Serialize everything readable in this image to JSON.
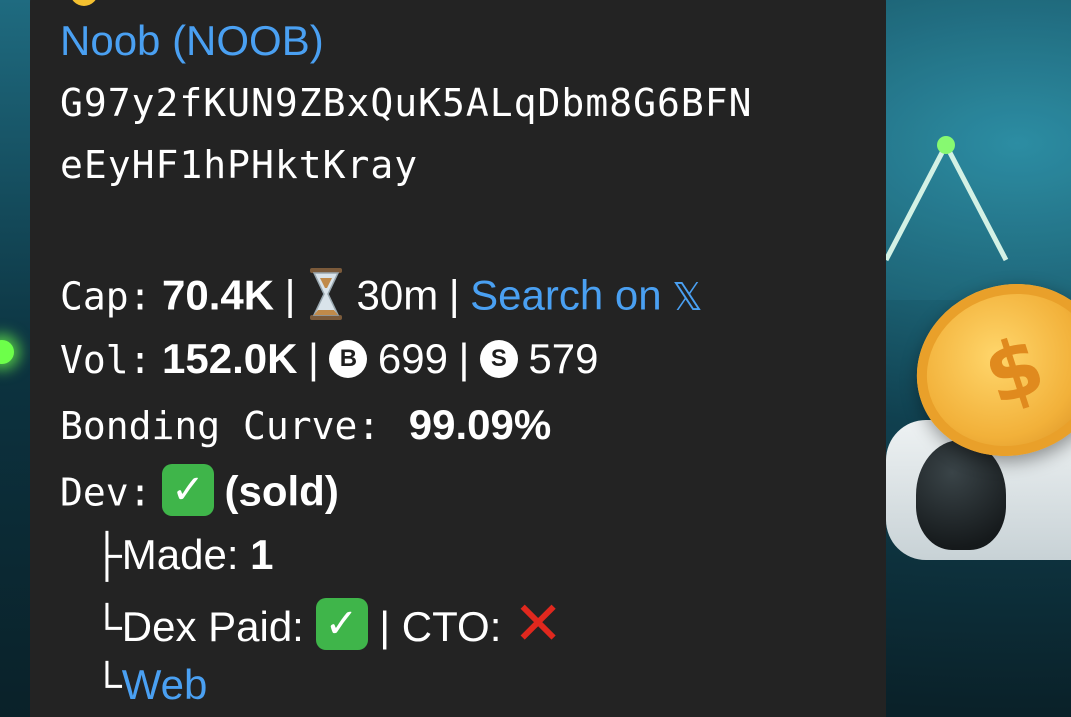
{
  "token": {
    "name_link": "Noob (NOOB)",
    "address_line1": "G97y2fKUN9ZBxQuK5ALqDbm8G6BFN",
    "address_line2": "eEyHF1hPHktKray"
  },
  "cap": {
    "label": "Cap:",
    "value": "70.4K",
    "sep1": "|",
    "age": "30m",
    "sep2": "|",
    "search_link": "Search on",
    "x_glyph": "𝕏",
    "hourglass_icon": "hourglass-icon"
  },
  "vol": {
    "label": "Vol:",
    "value": "152.0K",
    "sep1": "|",
    "buy_badge": "B",
    "buys": "699",
    "sep2": "|",
    "sell_badge": "S",
    "sells": "579"
  },
  "bonding": {
    "label": "Bonding Curve:",
    "value": "99.09%"
  },
  "dev": {
    "label": "Dev:",
    "check_icon": "check-mark-icon",
    "status": "(sold)"
  },
  "made": {
    "prefix": "├",
    "label": "Made:",
    "value": "1"
  },
  "dex": {
    "prefix": "└",
    "label": "Dex Paid:",
    "sep": "|",
    "cto_label": "CTO:",
    "cross_icon": "cross-mark-icon"
  },
  "web": {
    "prefix": "└",
    "link": "Web"
  },
  "colors": {
    "bubble": "#232323",
    "link": "#4aa0f2",
    "text": "#ffffff",
    "check_bg": "#3fb54a",
    "cross": "#e0281e"
  }
}
